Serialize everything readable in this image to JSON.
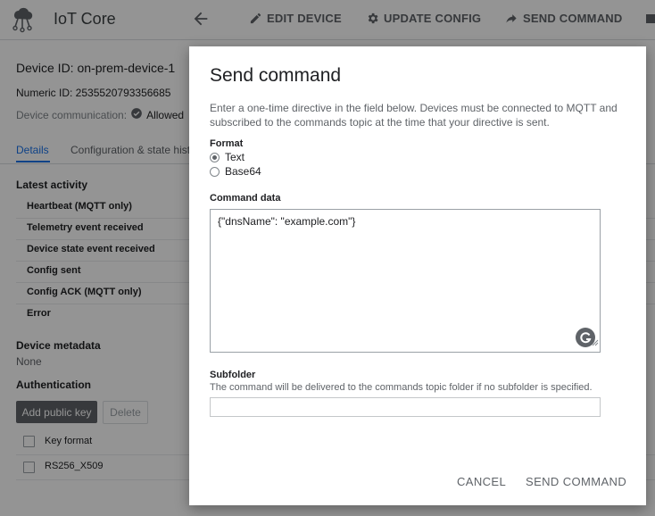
{
  "topbar": {
    "app_title": "IoT Core",
    "buttons": [
      {
        "label": "EDIT DEVICE",
        "icon": "pencil-icon"
      },
      {
        "label": "UPDATE CONFIG",
        "icon": "gear-icon"
      },
      {
        "label": "SEND COMMAND",
        "icon": "share-arrow-icon"
      }
    ]
  },
  "device": {
    "id_line": "Device ID: on-prem-device-1",
    "numeric_line": "Numeric ID: 2535520793356685",
    "comm_label": "Device communication:",
    "comm_value": "Allowed"
  },
  "tabs": [
    "Details",
    "Configuration & state hist"
  ],
  "latest_activity": {
    "heading": "Latest activity",
    "rows": [
      "Heartbeat (MQTT only)",
      "Telemetry event received",
      "Device state event received",
      "Config sent",
      "Config ACK (MQTT only)",
      "Error"
    ]
  },
  "metadata": {
    "heading": "Device metadata",
    "value": "None"
  },
  "authentication": {
    "heading": "Authentication",
    "add_label": "Add public key",
    "delete_label": "Delete",
    "column_header": "Key format",
    "rows": [
      "RS256_X509"
    ]
  },
  "dialog": {
    "title": "Send command",
    "description": "Enter a one-time directive in the field below. Devices must be connected to MQTT and subscribed to the commands topic at the time that your directive is sent.",
    "format_label": "Format",
    "format_options": [
      "Text",
      "Base64"
    ],
    "format_selected": "Text",
    "command_label": "Command data",
    "command_value": "{\"dnsName\": \"example.com\"}",
    "subfolder_label": "Subfolder",
    "subfolder_hint": "The command will be delivered to the commands topic folder if no subfolder is specified.",
    "subfolder_value": "",
    "cancel_label": "CANCEL",
    "send_label": "SEND COMMAND"
  },
  "colors": {
    "accent": "#1a73e8",
    "text": "#202124",
    "muted": "#5f6368",
    "overlay": "rgba(0,0,0,0.42)"
  }
}
